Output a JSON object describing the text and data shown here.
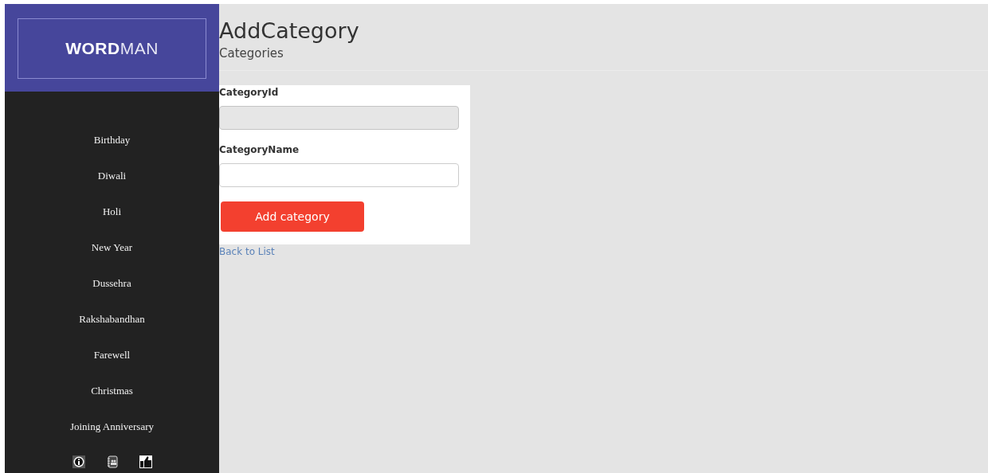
{
  "sidebar": {
    "logo": {
      "bold": "WORD",
      "light": "MAN"
    },
    "items": [
      {
        "label": "Birthday"
      },
      {
        "label": "Diwali"
      },
      {
        "label": "Holi"
      },
      {
        "label": "New Year"
      },
      {
        "label": "Dussehra"
      },
      {
        "label": "Rakshabandhan"
      },
      {
        "label": "Farewell"
      },
      {
        "label": "Christmas"
      },
      {
        "label": "Joining Anniversary"
      }
    ],
    "footer_icons": [
      {
        "kind": "info"
      },
      {
        "kind": "contacts"
      },
      {
        "kind": "like"
      }
    ]
  },
  "page": {
    "title": "AddCategory",
    "subtitle": "Categories"
  },
  "form": {
    "fields": [
      {
        "label": "CategoryId",
        "disabled": true
      },
      {
        "label": "CategoryName",
        "disabled": false
      }
    ],
    "submit": "Add category",
    "back_link": "Back to List"
  }
}
